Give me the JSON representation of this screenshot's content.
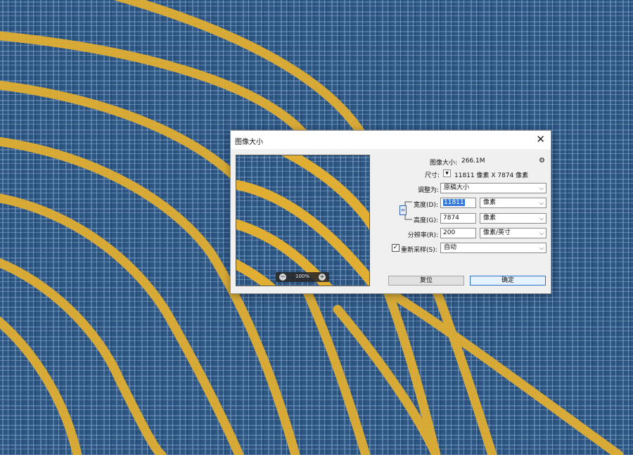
{
  "dialog": {
    "title": "图像大小",
    "close_glyph": "✕",
    "gear_glyph": "⚙"
  },
  "info": {
    "size_label": "图像大小:",
    "size_value": "266.1M",
    "dims_label": "尺寸:",
    "dims_value": "11811 像素  X  7874 像素"
  },
  "fields": {
    "fit_label": "调整为:",
    "fit_value": "原稿大小",
    "width_label": "宽度(D):",
    "width_value": "11811",
    "width_unit": "像素",
    "height_label": "高度(G):",
    "height_value": "7874",
    "height_unit": "像素",
    "res_label": "分辨率(R):",
    "res_value": "200",
    "res_unit": "像素/英寸",
    "resample_label": "重新采样(S):",
    "resample_value": "自动",
    "resample_checked": true
  },
  "preview": {
    "zoom": "100%"
  },
  "buttons": {
    "reset": "复位",
    "ok": "确定"
  },
  "colors": {
    "bg_blue": "#2c5582",
    "gold": "#e0ae33",
    "accent": "#2a6fc9"
  }
}
